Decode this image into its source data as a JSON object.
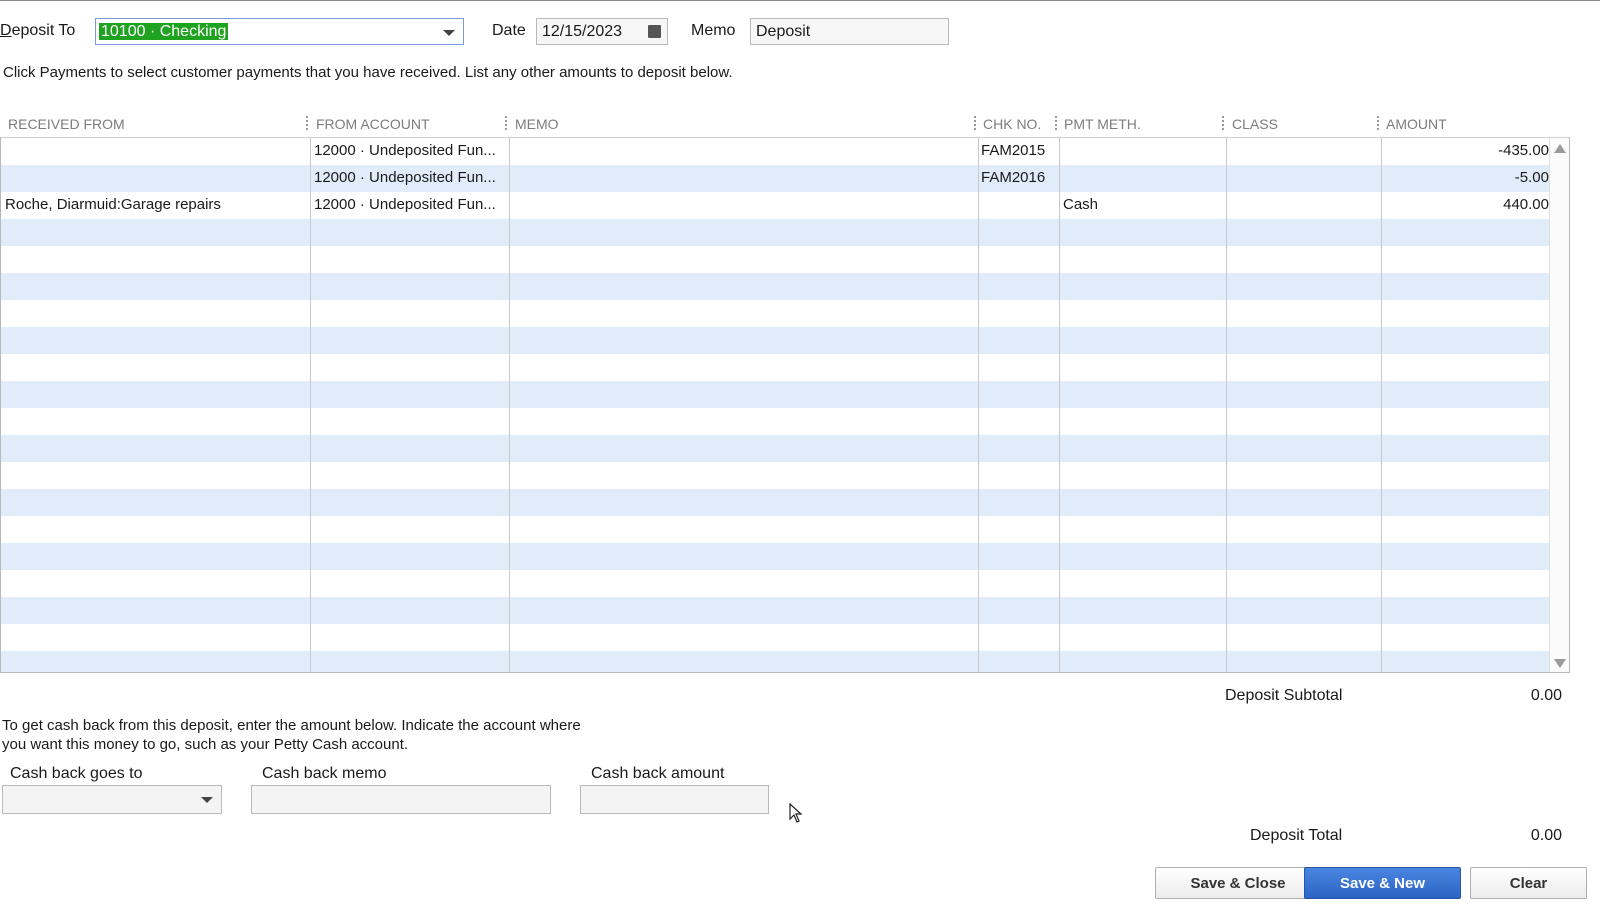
{
  "header": {
    "deposit_to_label_prefix": "D",
    "deposit_to_label_rest": "eposit To",
    "deposit_to_value": "10100 · Checking",
    "date_label": "Date",
    "date_value": "12/15/2023",
    "memo_label": "Memo",
    "memo_value": "Deposit"
  },
  "instruction": "Click Payments to select customer payments that you have received. List any other amounts to deposit below.",
  "grid": {
    "columns": [
      "RECEIVED FROM",
      "FROM ACCOUNT",
      "MEMO",
      "CHK NO.",
      "PMT METH.",
      "CLASS",
      "AMOUNT"
    ],
    "rows": [
      {
        "received_from": "",
        "from_account": "12000 · Undeposited Fun...",
        "memo": "",
        "chk_no": "FAM2015",
        "pmt_meth": "",
        "class": "",
        "amount": "-435.00"
      },
      {
        "received_from": "",
        "from_account": "12000 · Undeposited Fun...",
        "memo": "",
        "chk_no": "FAM2016",
        "pmt_meth": "",
        "class": "",
        "amount": "-5.00"
      },
      {
        "received_from": "Roche, Diarmuid:Garage repairs",
        "from_account": "12000 · Undeposited Fun...",
        "memo": "",
        "chk_no": "",
        "pmt_meth": "Cash",
        "class": "",
        "amount": "440.00"
      }
    ]
  },
  "subtotal": {
    "label": "Deposit Subtotal",
    "value": "0.00"
  },
  "cash_back": {
    "text_line1": "To get cash back from this deposit, enter the amount below.  Indicate the account where",
    "text_line2": "you want this money to go, such as your Petty Cash account.",
    "goes_to_label": "Cash back goes to",
    "memo_label": "Cash back memo",
    "amount_label": "Cash back amount"
  },
  "total": {
    "label": "Deposit Total",
    "value": "0.00"
  },
  "buttons": {
    "save_close": "Save & Close",
    "save_new": "Save & New",
    "clear": "Clear"
  },
  "colors": {
    "accent": "#2c64c4",
    "row_alt": "#e1ecfb",
    "selection": "#1fa21f"
  }
}
